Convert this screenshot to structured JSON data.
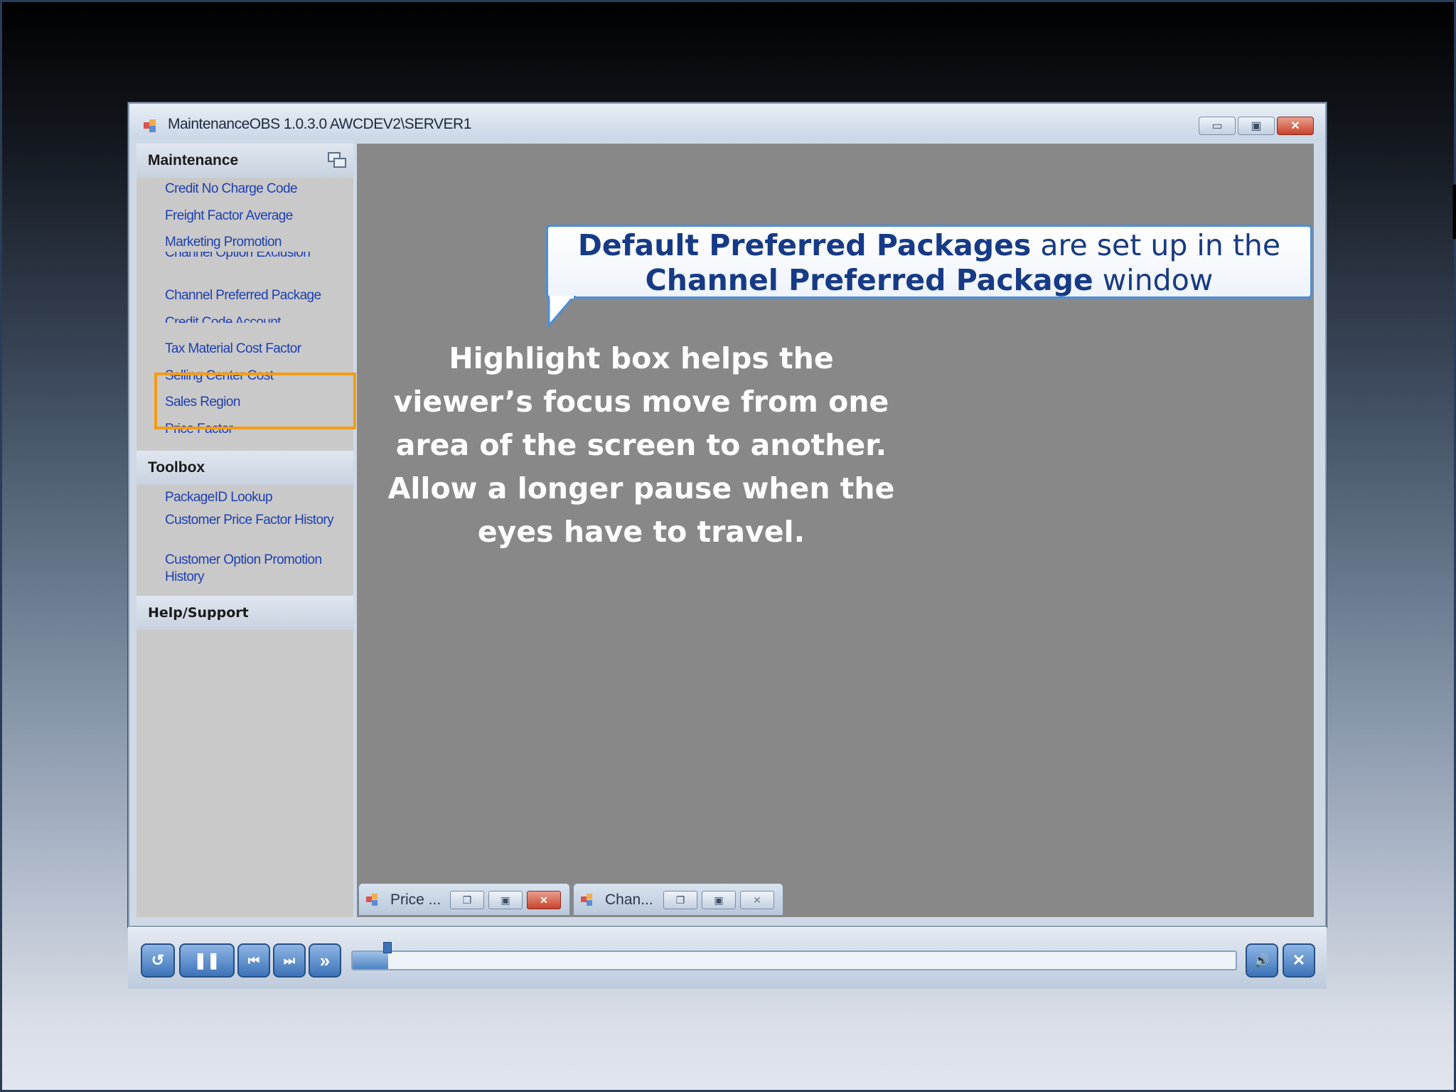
{
  "window": {
    "title": "MaintenanceOBS 1.0.3.0 AWCDEV2\\SERVER1",
    "controls": {
      "minimize": "▭",
      "restore": "▣",
      "close": "✕"
    }
  },
  "sidebar": {
    "maintenance_header": "Maintenance",
    "maintenance_items": [
      "Credit No Charge Code",
      "Freight Factor Average",
      "Marketing Promotion",
      "Channel Option Exclusion",
      "Channel Preferred Package",
      "Credit Code Account",
      "Tax Material Cost Factor",
      "Selling Center Cost",
      "Sales Region",
      "Price Factor"
    ],
    "toolbox_header": "Toolbox",
    "toolbox_items": [
      "PackageID Lookup",
      "Customer Price Factor History",
      "Customer Option Promotion History"
    ],
    "help_header": "Help/Support",
    "highlighted_item": "Channel Preferred Package"
  },
  "callout": {
    "bold_1": "Default Preferred Packages",
    "text_1": " are set up in the",
    "bold_2": "Channel Preferred Package",
    "text_2": " window"
  },
  "narration": "Highlight box helps the viewer’s focus move from one area of the screen to another. Allow a longer pause when the eyes have to travel.",
  "minimized_windows": [
    {
      "title": "Price ...",
      "close_active": true
    },
    {
      "title": "Chan...",
      "close_active": false
    }
  ],
  "player": {
    "replay": "↺",
    "pause": "❚❚",
    "prev": "⏮",
    "next": "⏭",
    "fast_forward": "»",
    "volume": "🔊",
    "exit": "✕",
    "progress_fraction": 0.04
  },
  "colors": {
    "link": "#1e3fb0",
    "highlight": "#f39c12",
    "callout_border": "#4a8fd8",
    "callout_text": "#183a82",
    "player_button": "#3d73b8"
  }
}
